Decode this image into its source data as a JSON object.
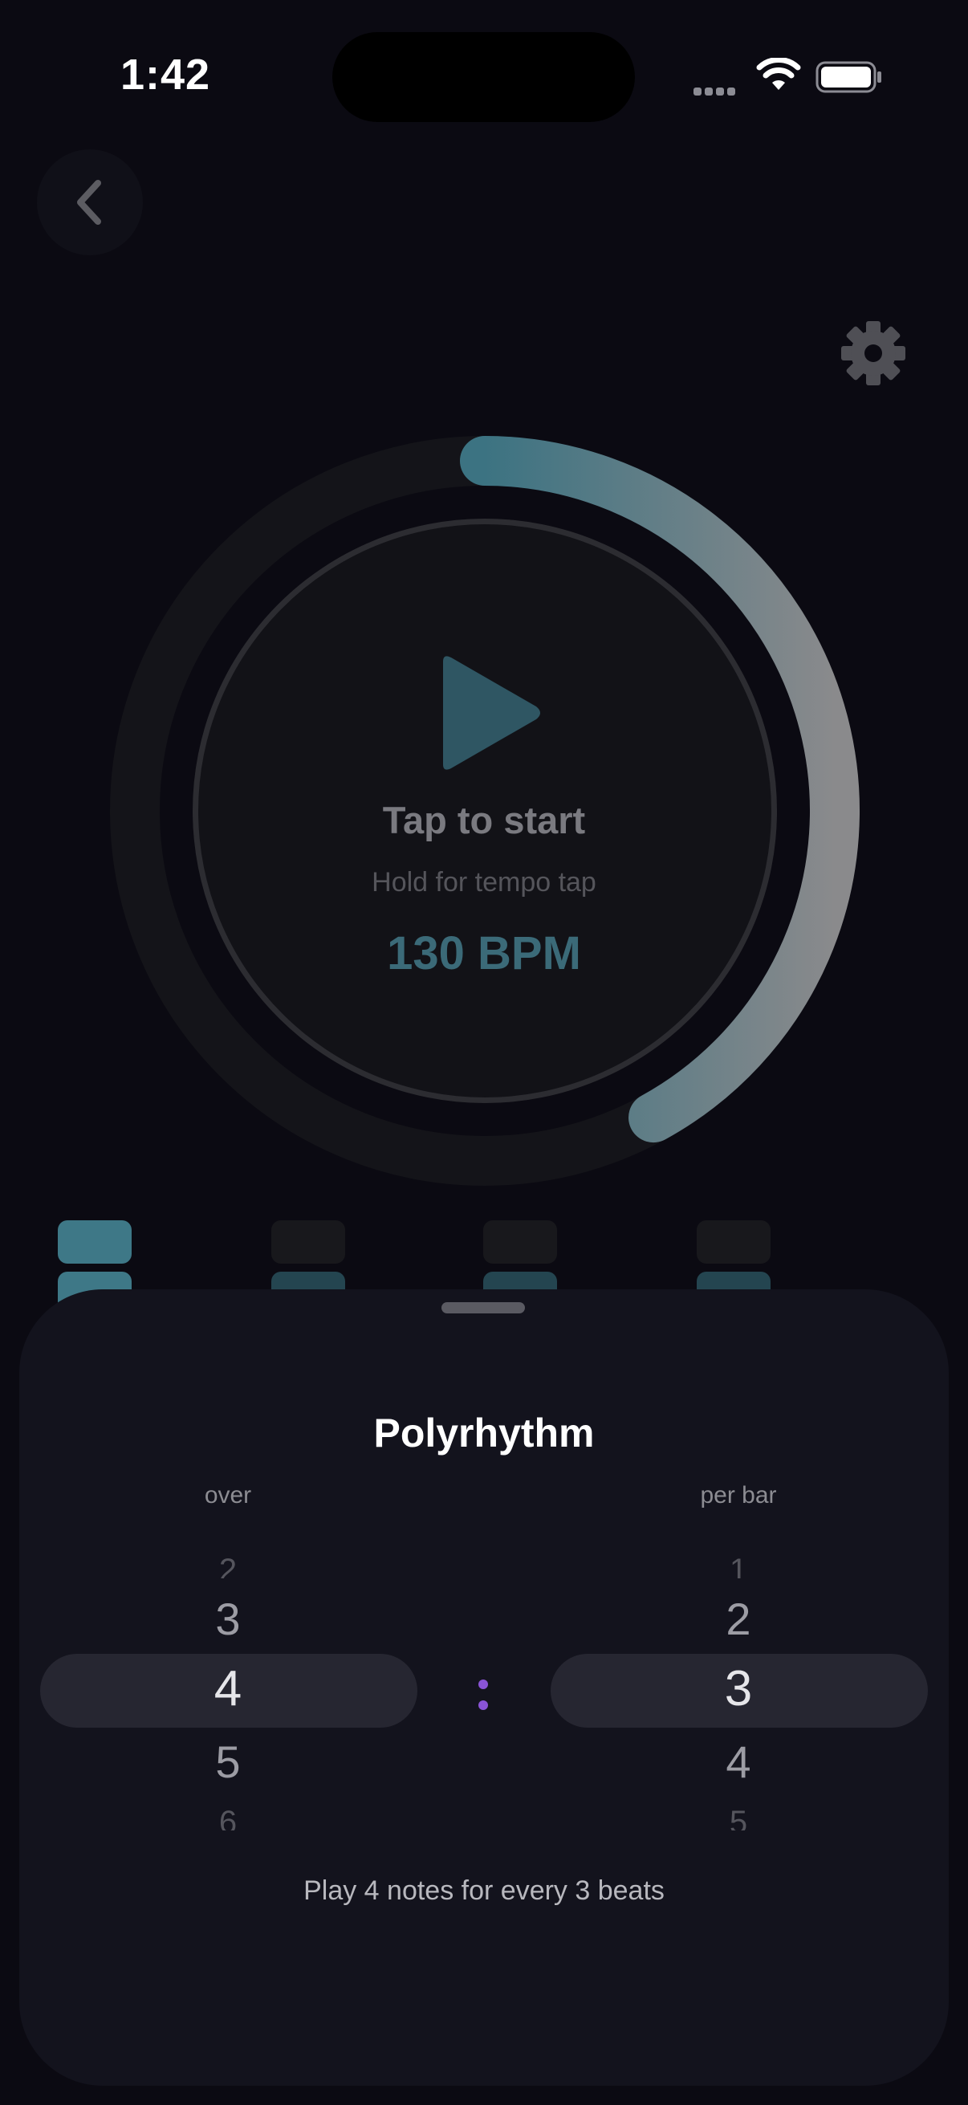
{
  "status_bar": {
    "time": "1:42"
  },
  "metronome": {
    "tap_label": "Tap to start",
    "hold_label": "Hold for tempo tap",
    "bpm_label": "130 BPM",
    "progress": 0.42
  },
  "beats": [
    {
      "active": true
    },
    {
      "active": false
    },
    {
      "active": false
    },
    {
      "active": false
    }
  ],
  "sheet": {
    "title": "Polyrhythm",
    "over_label": "over",
    "per_bar_label": "per bar",
    "left_picker": {
      "above2": "2",
      "above1": "3",
      "selected": "4",
      "below1": "5",
      "below2": "6"
    },
    "right_picker": {
      "above2": "1",
      "above1": "2",
      "selected": "3",
      "below1": "4",
      "below2": "5"
    },
    "description": "Play 4 notes for every 3 beats"
  },
  "icons": {
    "back": "chevron-left-icon",
    "settings": "gear-icon",
    "play": "play-icon",
    "wifi": "wifi-icon",
    "battery": "battery-icon",
    "signal": "cellular-signal-icon"
  },
  "colors": {
    "accent": "#3e7887",
    "picker_colon": "#8a54d6",
    "background": "#0b0a12"
  }
}
